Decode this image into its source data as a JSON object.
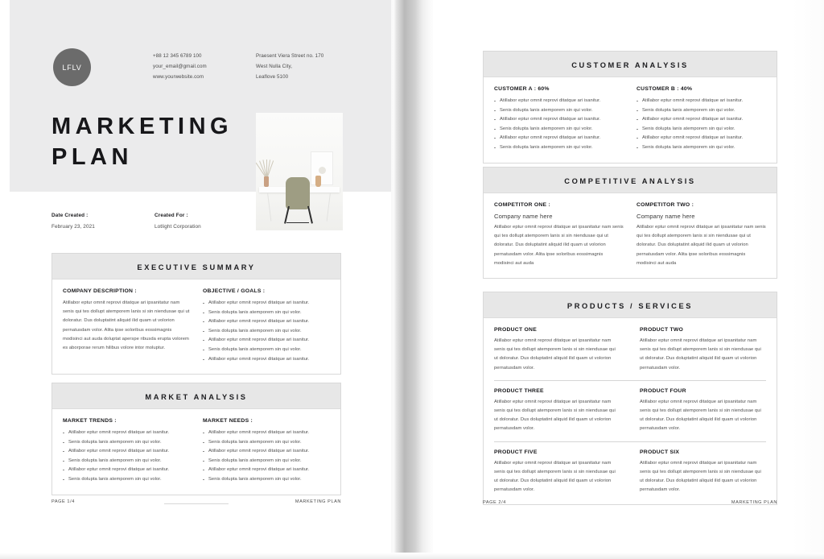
{
  "document": {
    "title": "MARKETING PLAN",
    "accent_color": "#6b6b6b",
    "header_band_color": "#ebebec",
    "card_head_color": "#e7e7e7"
  },
  "lorem": {
    "p_line1": "Atillabor eptur omnit reprovi ditatque ari ipsanitatur",
    "p_line2": "nam senis qui tes dollupt atemporem lanis si sin",
    "p_line3": "niendusae qui ut doloratur. Dus doluptatint aliquid",
    "p_line4": "ilid quam ut volorion pernatusdam volor. Alita ipse",
    "p_line5": "soloribus eossimagnis modisinci aut auda doluptat",
    "p_line6": "aperspe ribusda erupta volorem es aborporae rerum",
    "p_line7": "hilibus volore intor moluptur.",
    "p_short5": "soloribus eossimagnis modisinci aut auda",
    "p_short4": "ilid quam ut volorion pernatusdam volor.",
    "bullet_a": "Atillabor eptur omnit reprovi ditatque ari isanitur.",
    "bullet_b": "Senis dolupta lanis atemporem sin qui volor."
  },
  "left_page": {
    "logo": {
      "text": "LFLV"
    },
    "contact": {
      "phone": "+88 12 345 6789 100",
      "email": "your_email@gmail.com",
      "website": "www.yourwebsite.com",
      "address_line1": "Praesent Viera Street no. 170",
      "address_line2": "West Nulla City,",
      "address_line3": "Leaflove 5100"
    },
    "cover_title_line1": "MARKETING",
    "cover_title_line2": "PLAN",
    "meta": {
      "date_label": "Date Created :",
      "date_value": "February 23, 2021",
      "created_for_label": "Created For :",
      "created_for_value": "Lotlight Corporation"
    },
    "executive_summary": {
      "heading": "EXECUTIVE SUMMARY",
      "company_description_label": "COMPANY DESCRIPTION :",
      "company_description_paragraph": "Atillabor eptur omnit reprovi ditatque ari ipsanitatur nam senis qui tes dollupt atemporem lanis si sin niendusae qui ut doloratur. Dus doluptatint aliquid ilid quam ut volorion pernatusdam volor. Alita ipse soloribus eossimagnis modisinci aut auda doluptat aperspe ribusda erupta volorem es aborporae rerum hilibus volore intor moluptur.",
      "objective_label": "OBJECTIVE / GOALS :",
      "objective_bullets": [
        "Atillabor eptur omnit reprovi ditatque ari isanitur.",
        "Senis dolupta lanis atemporem sin qui volor.",
        "Atillabor eptur omnit reprovi ditatque ari isanitur.",
        "Senis dolupta lanis atemporem sin qui volor.",
        "Atillabor eptur omnit reprovi ditatque ari isanitur.",
        "Senis dolupta lanis atemporem sin qui volor.",
        "Atillabor eptur omnit reprovi ditatque ari isanitur."
      ]
    },
    "market_analysis": {
      "heading": "MARKET ANALYSIS",
      "trends_label": "MARKET TRENDS :",
      "trends_bullets": [
        "Atillabor eptur omnit reprovi ditatque ari isanitur.",
        "Senis dolupta lanis atemporem sin qui volor.",
        "Atillabor eptur omnit reprovi ditatque ari isanitur.",
        "Senis dolupta lanis atemporem sin qui volor.",
        "Atillabor eptur omnit reprovi ditatque ari isanitur.",
        "Senis dolupta lanis atemporem sin qui volor."
      ],
      "needs_label": "MARKET NEEDS :",
      "needs_bullets": [
        "Atillabor eptur omnit reprovi ditatque ari isanitur.",
        "Senis dolupta lanis atemporem sin qui volor.",
        "Atillabor eptur omnit reprovi ditatque ari isanitur.",
        "Senis dolupta lanis atemporem sin qui volor.",
        "Atillabor eptur omnit reprovi ditatque ari isanitur.",
        "Senis dolupta lanis atemporem sin qui volor."
      ]
    },
    "footer": {
      "page": "PAGE 1/4",
      "doc": "MARKETING PLAN"
    }
  },
  "right_page": {
    "customer_analysis": {
      "heading": "CUSTOMER ANALYSIS",
      "customer_a_label": "CUSTOMER A : 60%",
      "customer_a_bullets": [
        "Atillabor eptur omnit reprovi ditatque ari isanitur.",
        "Senis dolupta lanis atemporem sin qui volor.",
        "Atillabor eptur omnit reprovi ditatque ari isanitur.",
        "Senis dolupta lanis atemporem sin qui volor.",
        "Atillabor eptur omnit reprovi ditatque ari isanitur.",
        "Senis dolupta lanis atemporem sin qui volor."
      ],
      "customer_b_label": "CUSTOMER B : 40%",
      "customer_b_bullets": [
        "Atillabor eptur omnit reprovi ditatque ari isanitur.",
        "Senis dolupta lanis atemporem sin qui volor.",
        "Atillabor eptur omnit reprovi ditatque ari isanitur.",
        "Senis dolupta lanis atemporem sin qui volor.",
        "Atillabor eptur omnit reprovi ditatque ari isanitur.",
        "Senis dolupta lanis atemporem sin qui volor."
      ]
    },
    "competitive_analysis": {
      "heading": "COMPETITIVE ANALYSIS",
      "competitor_one_label": "COMPETITOR ONE :",
      "competitor_one_name": "Company name here",
      "competitor_one_paragraph": "Atillabor eptur omnit reprovi ditatque ari ipsanitatur nam senis qui tes dollupt atemporem lanis si sin niendusae qui ut doloratur. Dus doluptatint aliquid ilid quam ut volorion pernatusdam volor. Alita ipse soloribus eossimagnis modisinci aut auda",
      "competitor_two_label": "COMPETITOR TWO :",
      "competitor_two_name": "Company name here",
      "competitor_two_paragraph": "Atillabor eptur omnit reprovi ditatque ari ipsanitatur nam senis qui tes dollupt atemporem lanis si sin niendusae qui ut doloratur. Dus doluptatint aliquid ilid quam ut volorion pernatusdam volor. Alita ipse soloribus eossimagnis modisinci aut auda"
    },
    "products_services": {
      "heading": "PRODUCTS / SERVICES",
      "items": [
        {
          "title": "PRODUCT ONE",
          "paragraph": "Atillabor eptur omnit reprovi ditatque ari ipsanitatur nam senis qui tes dollupt atemporem lanis si sin niendusae qui ut doloratur. Dus doluptatint aliquid ilid quam ut volorion pernatusdam volor."
        },
        {
          "title": "PRODUCT TWO",
          "paragraph": "Atillabor eptur omnit reprovi ditatque ari ipsanitatur nam senis qui tes dollupt atemporem lanis si sin niendusae qui ut doloratur. Dus doluptatint aliquid ilid quam ut volorion pernatusdam volor."
        },
        {
          "title": "PRODUCT THREE",
          "paragraph": "Atillabor eptur omnit reprovi ditatque ari ipsanitatur nam senis qui tes dollupt atemporem lanis si sin niendusae qui ut doloratur. Dus doluptatint aliquid ilid quam ut volorion pernatusdam volor."
        },
        {
          "title": "PRODUCT FOUR",
          "paragraph": "Atillabor eptur omnit reprovi ditatque ari ipsanitatur nam senis qui tes dollupt atemporem lanis si sin niendusae qui ut doloratur. Dus doluptatint aliquid ilid quam ut volorion pernatusdam volor."
        },
        {
          "title": "PRODUCT FIVE",
          "paragraph": "Atillabor eptur omnit reprovi ditatque ari ipsanitatur nam senis qui tes dollupt atemporem lanis si sin niendusae qui ut doloratur. Dus doluptatint aliquid ilid quam ut volorion pernatusdam volor."
        },
        {
          "title": "PRODUCT SIX",
          "paragraph": "Atillabor eptur omnit reprovi ditatque ari ipsanitatur nam senis qui tes dollupt atemporem lanis si sin niendusae qui ut doloratur. Dus doluptatint aliquid ilid quam ut volorion pernatusdam volor."
        }
      ]
    },
    "footer": {
      "page": "PAGE 2/4",
      "doc": "MARKETING PLAN"
    }
  }
}
